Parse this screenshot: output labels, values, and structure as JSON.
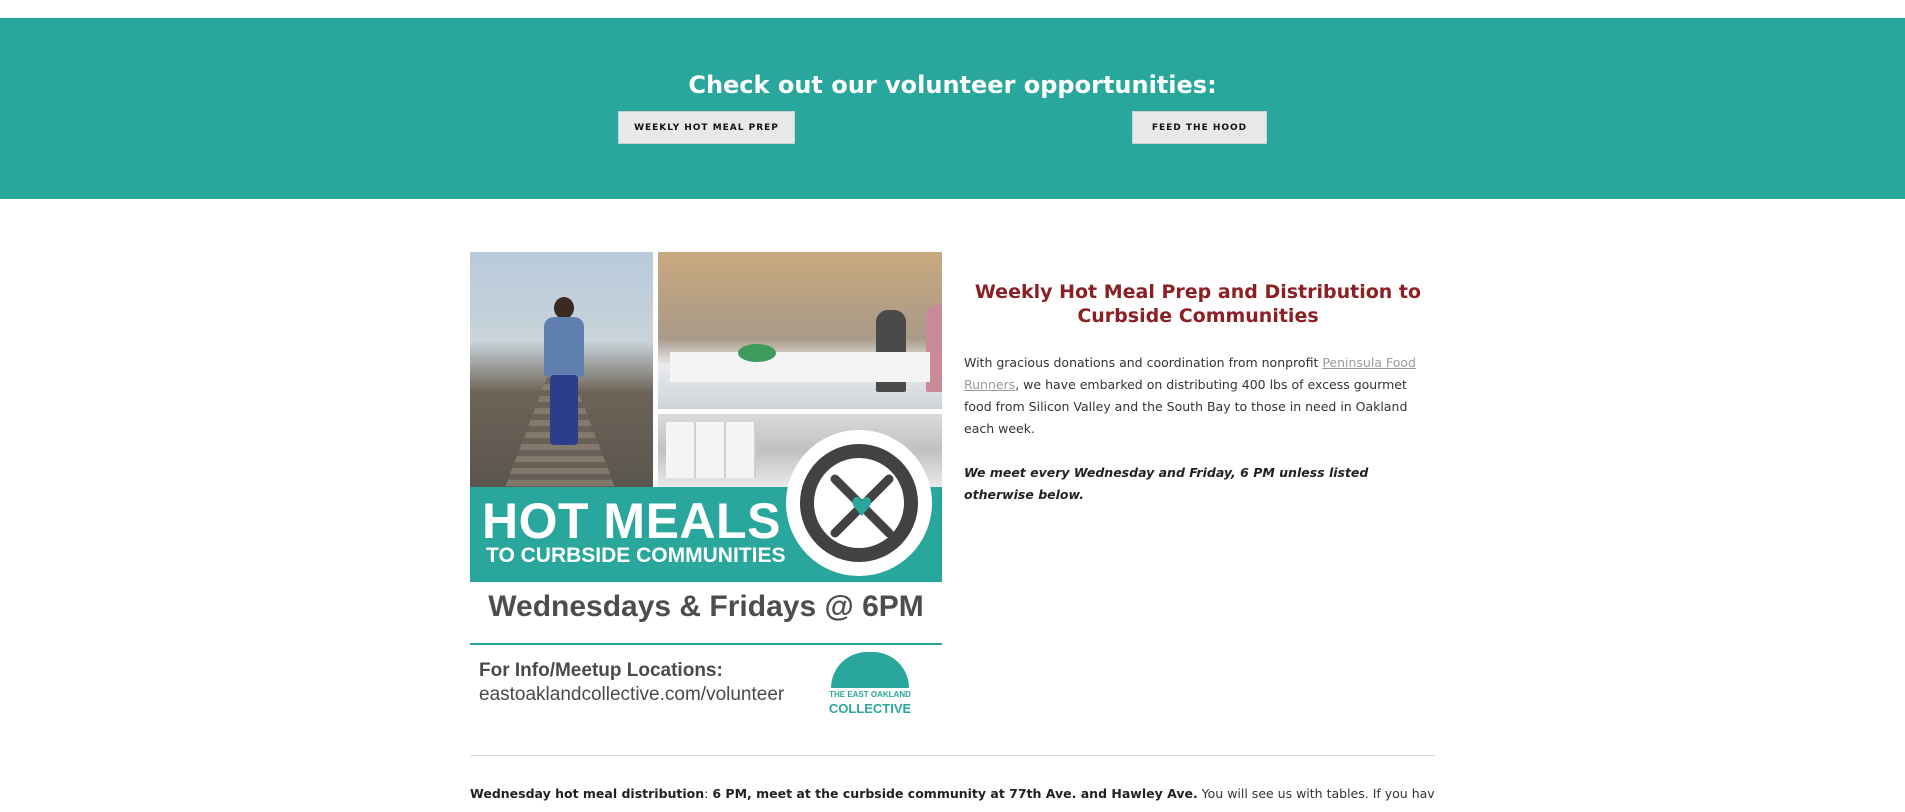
{
  "volunteer": {
    "heading": "Check out our volunteer opportunities:",
    "buttons": [
      {
        "label": "WEEKLY HOT MEAL PREP"
      },
      {
        "label": "FEED THE HOOD"
      }
    ],
    "accent_color": "#2aa79c"
  },
  "poster": {
    "headline": "HOT MEALS",
    "subheadline": "TO CURBSIDE COMMUNITIES",
    "schedule": "Wednesdays & Fridays @ 6PM",
    "info_label": "For Info/Meetup Locations:",
    "info_url": "eastoaklandcollective.com/volunteer",
    "logo_small": "THE EAST OAKLAND",
    "logo_big": "COLLECTIVE"
  },
  "article": {
    "title": "Weekly Hot Meal Prep and Distribution to Curbside Communities",
    "intro_before": "With gracious donations and coordination from nonprofit ",
    "intro_link": "Peninsula Food Runners",
    "intro_after": ", we have embarked on distributing 400 lbs of excess gourmet food from Silicon Valley and the South Bay to those in need in Oakland each week.",
    "meeting_note": "We meet every Wednesday and Friday, 6 PM unless listed otherwise below.",
    "title_color": "#8b1f24"
  },
  "distribution": {
    "label": "Wednesday hot meal distribution",
    "separator": ": ",
    "when_where": "6 PM, meet at the curbside community at 77th Ave. and Hawley Ave.",
    "details": " You will see us with tables. If you have any"
  }
}
